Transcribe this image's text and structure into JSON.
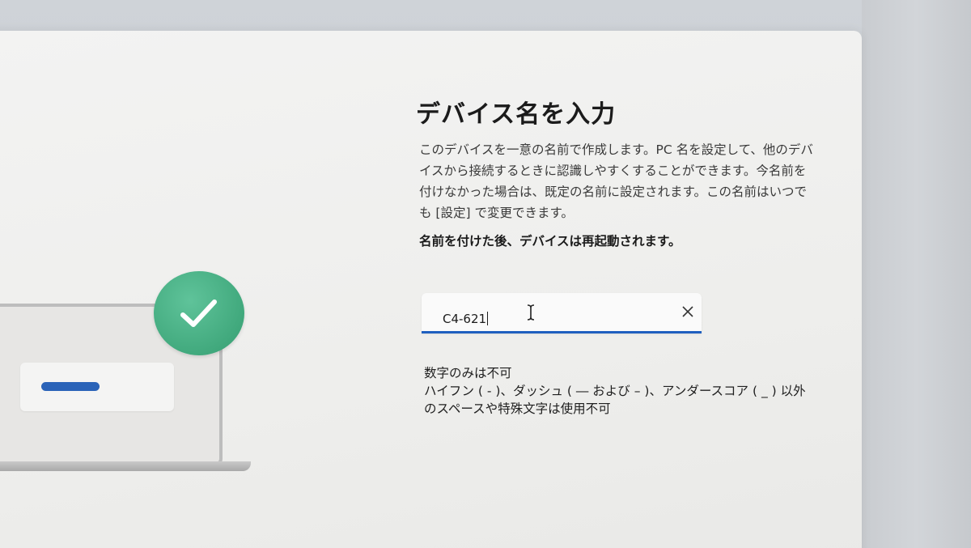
{
  "dialog": {
    "title": "デバイス名を入力",
    "description": [
      "このデバイスを一意の名前で作成します。PC 名を設定して、他のデバ",
      "イスから接続するときに認識しやすくすることができます。今名前を",
      "付けなかった場合は、既定の名前に設定されます。この名前はいつで",
      "も [設定] で変更できます。"
    ],
    "restart_notice": "名前を付けた後、デバイスは再起動されます。",
    "name_input": {
      "value": "C4-621",
      "clear_icon": "close-icon"
    },
    "validation_rules": [
      "数字のみは不可",
      "ハイフン ( - )、ダッシュ ( ― および – )、アンダースコア ( _ ) 以外",
      "のスペースや特殊文字は使用不可"
    ]
  },
  "illustration": {
    "icon": "check-icon",
    "badge_color": "#46ad82",
    "bar_color": "#2a63b8"
  },
  "colors": {
    "accent": "#1f5fbf",
    "panel_bg": "#f0f0ef"
  }
}
